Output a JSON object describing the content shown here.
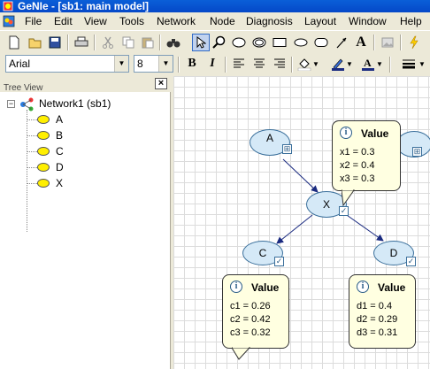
{
  "window": {
    "title": "GeNIe - [sb1: main model]"
  },
  "menu": [
    "File",
    "Edit",
    "View",
    "Tools",
    "Network",
    "Node",
    "Diagnosis",
    "Layout",
    "Window",
    "Help"
  ],
  "format": {
    "font": "Arial",
    "size": "8"
  },
  "tree": {
    "header": "Tree View",
    "close": "×",
    "root_label": "Network1 (sb1)",
    "expander": "−",
    "nodes": [
      "A",
      "B",
      "C",
      "D",
      "X"
    ]
  },
  "canvas": {
    "nodes": [
      {
        "id": "A",
        "label": "A"
      },
      {
        "id": "X",
        "label": "X"
      },
      {
        "id": "C",
        "label": "C"
      },
      {
        "id": "D",
        "label": "D"
      }
    ],
    "tooltips": {
      "x": {
        "title": "Value",
        "rows": [
          "x1 = 0.3",
          "x2 = 0.4",
          "x3 = 0.3"
        ]
      },
      "c": {
        "title": "Value",
        "rows": [
          "c1 = 0.26",
          "c2 = 0.42",
          "c3 = 0.32"
        ]
      },
      "d": {
        "title": "Value",
        "rows": [
          "d1 = 0.4",
          "d2 = 0.29",
          "d3 = 0.31"
        ]
      }
    }
  },
  "colors": {
    "node_fill": "#d5e9f7",
    "tree_node": "#ffef00",
    "tooltip_bg": "#ffffe1",
    "titlebar": "#0548c8"
  }
}
